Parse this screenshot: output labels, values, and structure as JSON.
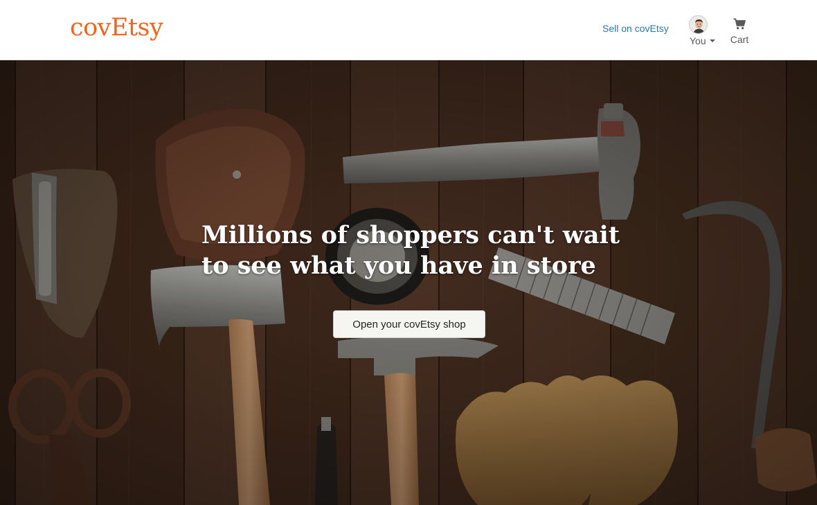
{
  "header": {
    "logo": "covEtsy",
    "sell_link": "Sell on covEtsy",
    "user_menu_label": "You",
    "cart_label": "Cart"
  },
  "hero": {
    "title": "Millions of shoppers can't wait\nto see what you have in store",
    "cta_label": "Open your covEtsy shop"
  },
  "colors": {
    "brand": "#f1641e",
    "link": "#2a7aa8",
    "hero_background": "#4a3020"
  },
  "icons": {
    "cart": "cart-icon",
    "user_avatar": "avatar",
    "dropdown": "caret-down-icon"
  }
}
